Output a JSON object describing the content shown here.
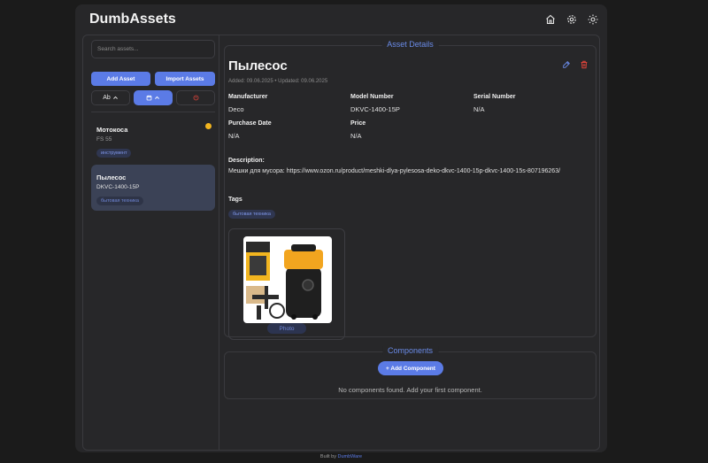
{
  "app": {
    "title": "DumbAssets"
  },
  "header": {
    "icons": [
      "home-icon",
      "gear-icon",
      "sun-icon"
    ]
  },
  "sidebar": {
    "search_placeholder": "Search assets...",
    "add_asset_label": "Add Asset",
    "import_assets_label": "Import Assets",
    "sort_name_label": "Ab",
    "assets": [
      {
        "name": "Мотокоса",
        "model": "FS 55",
        "tag": "инструмент",
        "warning": true
      },
      {
        "name": "Пылесос",
        "model": "DKVC-1400-15P",
        "tag": "бытовая техника",
        "active": true
      }
    ]
  },
  "details": {
    "legend": "Asset Details",
    "title": "Пылесос",
    "dates": "Added: 09.06.2025 • Updated: 09.06.2025",
    "manufacturer_label": "Manufacturer",
    "manufacturer": "Deco",
    "model_label": "Model Number",
    "model": "DKVC-1400-15P",
    "serial_label": "Serial Number",
    "serial": "N/A",
    "purchase_date_label": "Purchase Date",
    "purchase_date": "N/A",
    "price_label": "Price",
    "price": "N/A",
    "description_label": "Description:",
    "description": "Мешки для мусора: https://www.ozon.ru/product/meshki-dlya-pylesosa-deko-dkvc-1400-15p-dkvc-1400-15s-807196263/",
    "tags_label": "Tags",
    "tags": [
      "бытовая техника"
    ],
    "photo_label": "Photo"
  },
  "components": {
    "legend": "Components",
    "add_label": "+ Add Component",
    "empty_text": "No components found. Add your first component."
  },
  "footer": {
    "prefix": "Built by",
    "link": "DumbWare"
  },
  "colors": {
    "accent": "#5b7be6",
    "danger": "#e0443a",
    "warning": "#f2b51f",
    "background": "#272729"
  }
}
